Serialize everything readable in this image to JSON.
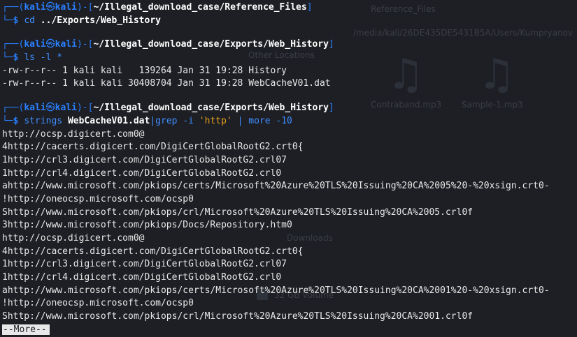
{
  "background": {
    "window_title": "Reference_Files",
    "path_bar": "/media/kali/26DE435DE5431B5A/Users/Kumpryanov",
    "section_other": "Other Locations",
    "file1": "Contraband.mp3",
    "file2": "Sample-1.mp3",
    "sidebar_downloads": "Downloads",
    "volume": "32 GB Volume"
  },
  "prompts": [
    {
      "user": "kali",
      "host": "kali",
      "path": "~/Illegal_download_case/Reference_Files",
      "command": "cd",
      "args": "../Exports/Web_History"
    },
    {
      "user": "kali",
      "host": "kali",
      "path": "~/Illegal_download_case/Exports/Web_History",
      "command": "ls",
      "args": "-l *"
    },
    {
      "user": "kali",
      "host": "kali",
      "path": "~/Illegal_download_case/Exports/Web_History",
      "command": "strings",
      "file": "WebCacheV01.dat",
      "pipe1": "|",
      "grep": "grep",
      "grep_flag": "-i",
      "pattern": "'http'",
      "pipe2": "|",
      "more": "more",
      "more_flag": "-10"
    }
  ],
  "ls_output": [
    "-rw-r--r-- 1 kali kali   139264 Jan 31 19:28 History",
    "-rw-r--r-- 1 kali kali 30408704 Jan 31 19:28 WebCacheV01.dat"
  ],
  "strings_output": [
    "http://ocsp.digicert.com0@",
    "4http://cacerts.digicert.com/DigiCertGlobalRootG2.crt0{",
    "1http://crl3.digicert.com/DigiCertGlobalRootG2.crl07",
    "1http://crl4.digicert.com/DigiCertGlobalRootG2.crl0",
    "ahttp://www.microsoft.com/pkiops/certs/Microsoft%20Azure%20TLS%20Issuing%20CA%2005%20-%20xsign.crt0-",
    "!http://oneocsp.microsoft.com/ocsp0",
    "Shttp://www.microsoft.com/pkiops/crl/Microsoft%20Azure%20TLS%20Issuing%20CA%2005.crl0f",
    "3http://www.microsoft.com/pkiops/Docs/Repository.htm0",
    "http://ocsp.digicert.com0@",
    "4http://cacerts.digicert.com/DigiCertGlobalRootG2.crt0{",
    "1http://crl3.digicert.com/DigiCertGlobalRootG2.crl07",
    "1http://crl4.digicert.com/DigiCertGlobalRootG2.crl0",
    "ahttp://www.microsoft.com/pkiops/certs/Microsoft%20Azure%20TLS%20Issuing%20CA%2001%20-%20xsign.crt0-",
    "!http://oneocsp.microsoft.com/ocsp0",
    "Shttp://www.microsoft.com/pkiops/crl/Microsoft%20Azure%20TLS%20Issuing%20CA%2001.crl0f"
  ],
  "pager_status": "--More--",
  "glyphs": {
    "prompt_top_left": "┌──(",
    "prompt_at": "㉿",
    "prompt_mid": ")-[",
    "prompt_close": "]",
    "prompt_bottom": "└─",
    "prompt_dollar": "$"
  },
  "colors": {
    "accent_blue": "#2a7fff",
    "string_orange": "#e59f1b",
    "background": "#1d1f24"
  }
}
